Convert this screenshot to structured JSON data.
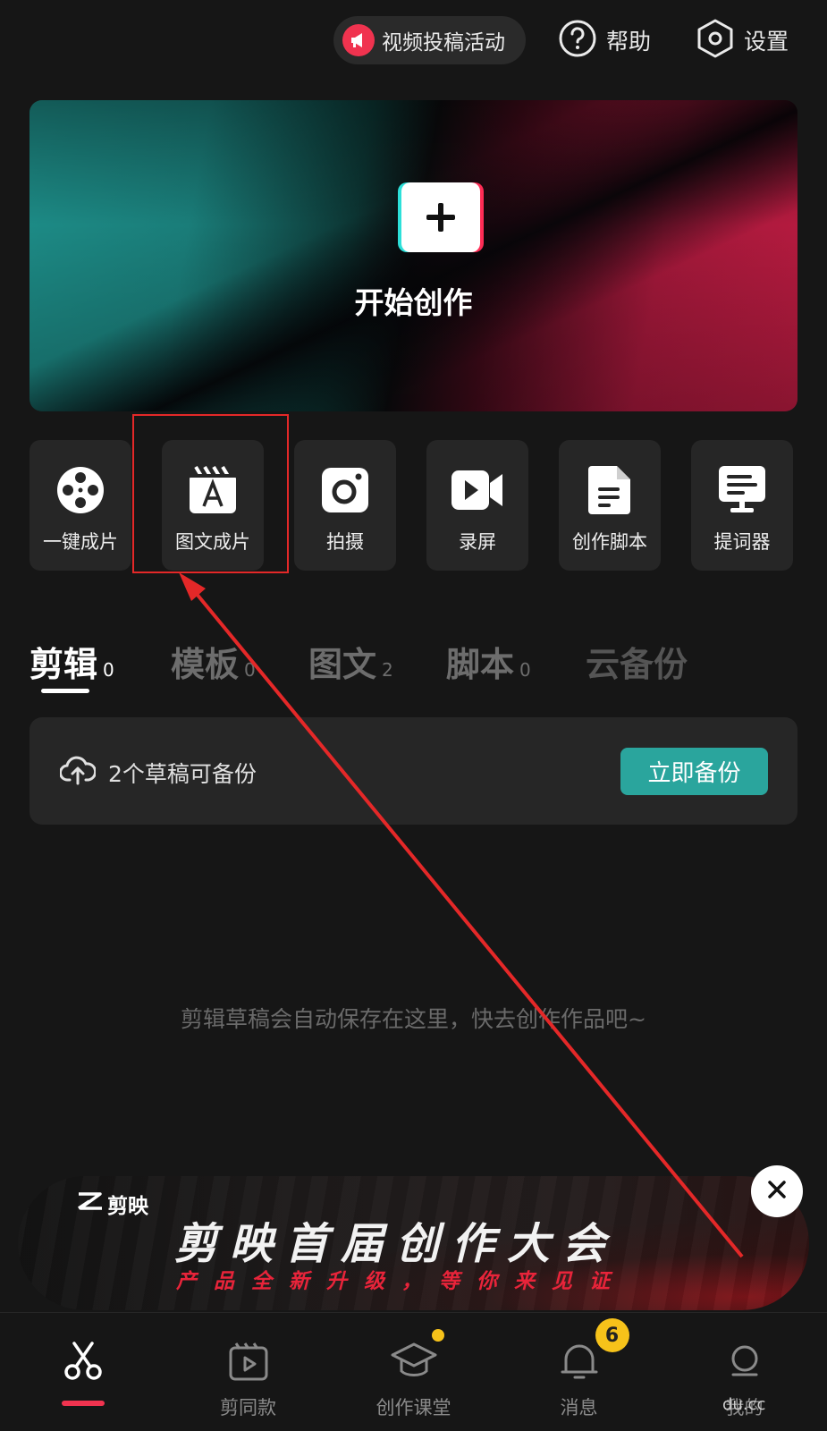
{
  "topbar": {
    "promo_label": "视频投稿活动",
    "help_label": "帮助",
    "settings_label": "设置"
  },
  "hero": {
    "title": "开始创作"
  },
  "tools": [
    {
      "label": "一键成片",
      "icon": "film-reel-icon"
    },
    {
      "label": "图文成片",
      "icon": "clapper-text-icon"
    },
    {
      "label": "拍摄",
      "icon": "camera-icon"
    },
    {
      "label": "录屏",
      "icon": "video-record-icon"
    },
    {
      "label": "创作脚本",
      "icon": "script-doc-icon"
    },
    {
      "label": "提词器",
      "icon": "teleprompter-icon"
    }
  ],
  "tabs": [
    {
      "label": "剪辑",
      "count": "0",
      "active": true
    },
    {
      "label": "模板",
      "count": "0"
    },
    {
      "label": "图文",
      "count": "2"
    },
    {
      "label": "脚本",
      "count": "0"
    },
    {
      "label": "云备份",
      "count": ""
    }
  ],
  "backup": {
    "text": "2个草稿可备份",
    "button": "立即备份"
  },
  "empty_hint": "剪辑草稿会自动保存在这里，快去创作作品吧~",
  "banner": {
    "brand": "剪映",
    "headline": "剪映首届创作大会",
    "subline": "产品全新升级，等你来见证"
  },
  "bottom_nav": [
    {
      "label": "",
      "icon": "scissors-icon",
      "active": true
    },
    {
      "label": "剪同款",
      "icon": "template-play-icon"
    },
    {
      "label": "创作课堂",
      "icon": "graduation-cap-icon",
      "dot": true
    },
    {
      "label": "消息",
      "icon": "bell-icon",
      "badge": "6"
    },
    {
      "label": "我的",
      "icon": "profile-icon"
    }
  ],
  "watermark": "du.cc",
  "colors": {
    "accent_red": "#f0334f",
    "accent_teal": "#2aa59d",
    "badge_yellow": "#f6c21a",
    "annotation_red": "#e42828"
  }
}
